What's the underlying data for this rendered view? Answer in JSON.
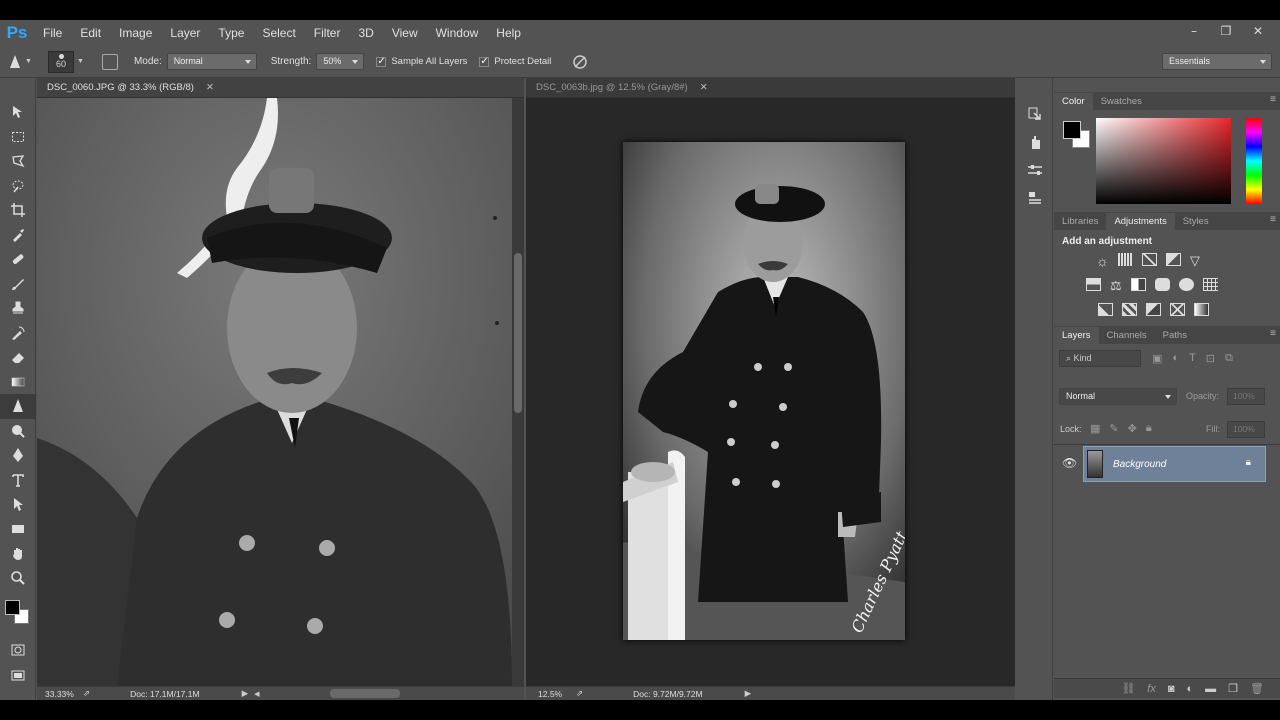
{
  "app": {
    "logo": "Ps"
  },
  "menu": [
    "File",
    "Edit",
    "Image",
    "Layer",
    "Type",
    "Select",
    "Filter",
    "3D",
    "View",
    "Window",
    "Help"
  ],
  "window_controls": {
    "minimize": "–",
    "restore": "❐",
    "close": "✕"
  },
  "options": {
    "brush_size": "60",
    "mode_label": "Mode:",
    "mode_value": "Normal",
    "strength_label": "Strength:",
    "strength_value": "50%",
    "sample_all_layers": "Sample All Layers",
    "protect_detail": "Protect Detail",
    "workspace": "Essentials"
  },
  "documents": [
    {
      "title": "DSC_0060.JPG @ 33.3% (RGB/8)",
      "zoom": "33.33%",
      "doc_size": "Doc: 17.1M/17.1M"
    },
    {
      "title": "DSC_0063b.jpg @ 12.5% (Gray/8#)",
      "zoom": "12.5%",
      "doc_size": "Doc: 9.72M/9.72M"
    }
  ],
  "color_panel": {
    "tabs": [
      "Color",
      "Swatches"
    ],
    "foreground": "#000000",
    "background": "#ffffff",
    "hue": "#e8262c"
  },
  "adjustments_panel": {
    "tabs": [
      "Libraries",
      "Adjustments",
      "Styles"
    ],
    "heading": "Add an adjustment"
  },
  "layers_panel": {
    "tabs": [
      "Layers",
      "Channels",
      "Paths"
    ],
    "filter_kind": "Kind",
    "blend_mode": "Normal",
    "opacity_label": "Opacity:",
    "opacity_value": "100%",
    "lock_label": "Lock:",
    "fill_label": "Fill:",
    "fill_value": "100%",
    "layers": [
      {
        "name": "Background",
        "visible": true,
        "locked": true
      }
    ]
  },
  "signature": "Charles Pyatt"
}
